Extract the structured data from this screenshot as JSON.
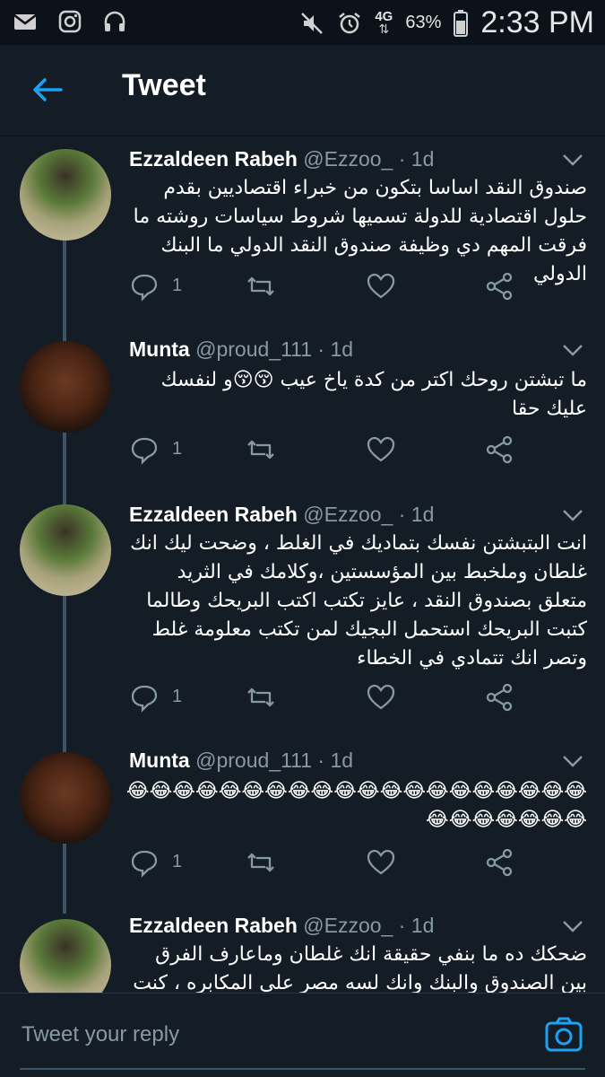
{
  "status_bar": {
    "battery": "63%",
    "network": "4G",
    "time": "2:33 PM"
  },
  "header": {
    "title": "Tweet"
  },
  "tweets": [
    {
      "author": "Ezzaldeen Rabeh",
      "handle": "@Ezzoo_ · 1d",
      "text": "صندوق النقد اساسا  بتكون من خبراء اقتصاديين بقدم حلول اقتصادية للدولة تسميها شروط سياسات روشته ما فرقت المهم دي وظيفة صندوق النقد الدولي ما البنك الدولي",
      "reply_count": "1"
    },
    {
      "author": "Munta",
      "handle": "@proud_111 · 1d",
      "text": "ما تبشتن روحك اكتر من كدة ياخ عيب 😚😚و لنفسك عليك حقا",
      "reply_count": "1"
    },
    {
      "author": "Ezzaldeen Rabeh",
      "handle": "@Ezzoo_ · 1d",
      "text": "انت البتبشتن نفسك بتماديك في الغلط ، وضحت ليك انك غلطان وملخبط بين المؤسستين ،وكلامك في الثريد متعلق بصندوق النقد ، عايز تكتب اكتب البريحك وطالما كتبت البريحك استحمل البجيك لمن تكتب معلومة غلط وتصر انك تتمادي في الخطاء",
      "reply_count": "1"
    },
    {
      "author": "Munta",
      "handle": "@proud_111 · 1d",
      "text": "😂😂😂😂😂😂😂😂😂😂😂😂😂😂😂😂😂😂😂😂😂😂😂😂😂😂😂",
      "reply_count": "1"
    },
    {
      "author": "Ezzaldeen Rabeh",
      "handle": "@Ezzoo_ · 1d",
      "text": "ضحكك ده ما بنفي حقيقة انك غلطان وماعارف الفرق بين الصندوق والبنك وانك لسه مصر علي المكابره ، كنت فاكرك",
      "reply_count": ""
    }
  ],
  "composer": {
    "placeholder": "Tweet your reply"
  },
  "icons": {
    "status_left": [
      "mail-icon",
      "instagram-icon",
      "headphones-icon"
    ],
    "status_right": [
      "mute-icon",
      "alarm-icon",
      "network-icon",
      "battery-icon"
    ],
    "actions": [
      "reply-icon",
      "retweet-icon",
      "like-icon",
      "share-icon"
    ]
  },
  "colors": {
    "background": "#141d26",
    "accent": "#1da1f2",
    "secondary_text": "#8899a6"
  }
}
